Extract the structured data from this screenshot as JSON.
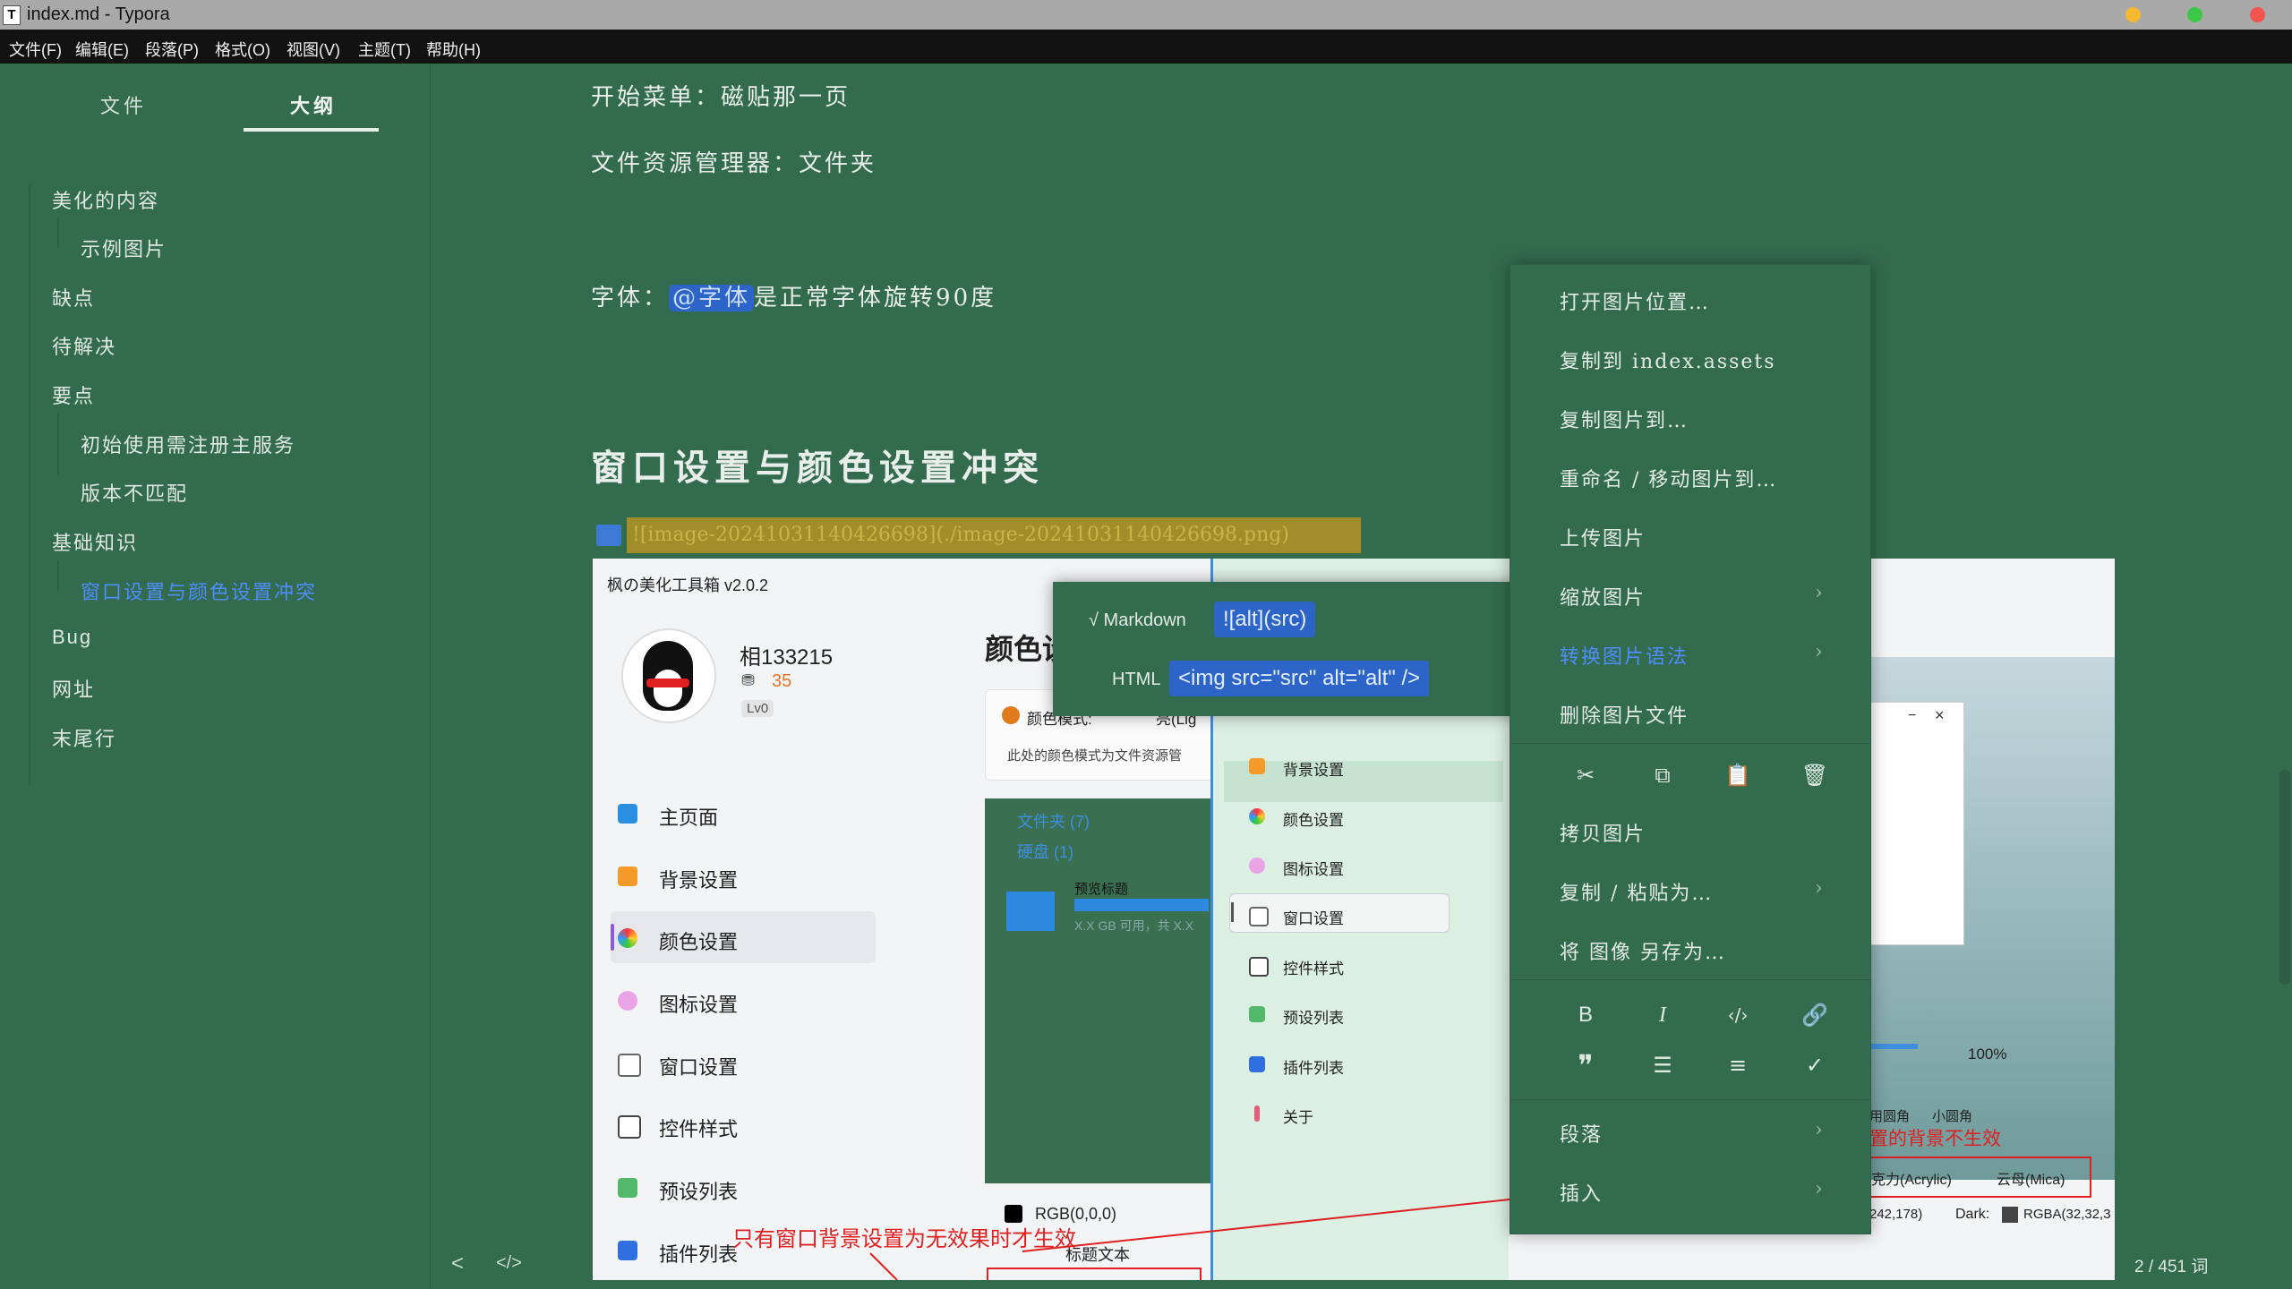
{
  "window": {
    "title": "index.md - Typora",
    "app_icon": "T"
  },
  "menubar": [
    "文件(F)",
    "编辑(E)",
    "段落(P)",
    "格式(O)",
    "视图(V)",
    "主题(T)",
    "帮助(H)"
  ],
  "sidebar": {
    "tabs": [
      {
        "label": "文件"
      },
      {
        "label": "大纲"
      }
    ],
    "outline": [
      {
        "label": "美化的内容",
        "level": 1
      },
      {
        "label": "示例图片",
        "level": 2
      },
      {
        "label": "缺点",
        "level": 1
      },
      {
        "label": "待解决",
        "level": 1
      },
      {
        "label": "要点",
        "level": 1
      },
      {
        "label": "初始使用需注册主服务",
        "level": 2
      },
      {
        "label": "版本不匹配",
        "level": 2
      },
      {
        "label": "基础知识",
        "level": 1
      },
      {
        "label": "窗口设置与颜色设置冲突",
        "level": 2,
        "active": true
      },
      {
        "label": "Bug",
        "level": 1
      },
      {
        "label": "网址",
        "level": 1
      },
      {
        "label": "末尾行",
        "level": 1
      }
    ]
  },
  "editor": {
    "line1": "开始菜单：磁贴那一页",
    "line2": "文件资源管理器：文件夹",
    "line3_prefix": "字体：",
    "line3_tag": "@字体",
    "line3_suffix": "是正常字体旋转90度",
    "heading": "窗口设置与颜色设置冲突",
    "image_source": "![image-20241031140426698](./image-20241031140426698.png)"
  },
  "screenshot": {
    "app_title": "枫の美化工具箱 v2.0.2",
    "username": "相133215",
    "coins": "35",
    "level": "Lv0",
    "section_title": "颜色设",
    "color_mode": "颜色模式:",
    "color_mode_value": "亮(Lig",
    "color_hint": "此处的颜色模式为文件资源管",
    "folder_group": "文件夹 (7)",
    "disk_group": "硬盘 (1)",
    "preview_title": "预览标题",
    "disk_free": "X.X GB 可用，共 X.X",
    "rgb": "RGB(0,0,0)",
    "title_text": "标题文本",
    "annotation": "只有窗口背景设置为无效果时才生效",
    "annotation_right": "置的背景不生效",
    "nav": [
      "主页面",
      "背景设置",
      "颜色设置",
      "图标设置",
      "窗口设置",
      "控件样式",
      "预设列表",
      "插件列表"
    ],
    "panel2_nav": [
      "背景设置",
      "颜色设置",
      "图标设置",
      "窗口设置",
      "控件样式",
      "预设列表",
      "插件列表",
      "关于"
    ],
    "percent": "100%",
    "rounded": "用圆角",
    "small_rounded": "小圆角",
    "acrylic": "克力(Acrylic)",
    "mica": "云母(Mica)",
    "rgba_left": "242,178)",
    "dark_label": "Dark:",
    "rgba_dark": "RGBA(32,32,3"
  },
  "context_menu": {
    "items": [
      "打开图片位置…",
      "复制到 index.assets",
      "复制图片到…",
      "重命名 / 移动图片到…",
      "上传图片",
      "缩放图片",
      "转换图片语法",
      "删除图片文件",
      "拷贝图片",
      "复制 / 粘贴为…",
      "将 图像 另存为…",
      "段落",
      "插入"
    ]
  },
  "submenu": {
    "markdown_label": "√ Markdown",
    "markdown_code": "![alt](src)",
    "html_label": "HTML",
    "html_code": "<img src=\"src\" alt=\"alt\" />"
  },
  "statusbar": {
    "back": "<",
    "source": "</>",
    "words": "2 / 451 词"
  },
  "colors": {
    "background": "#336b4f",
    "accent": "#4e8dfa"
  }
}
